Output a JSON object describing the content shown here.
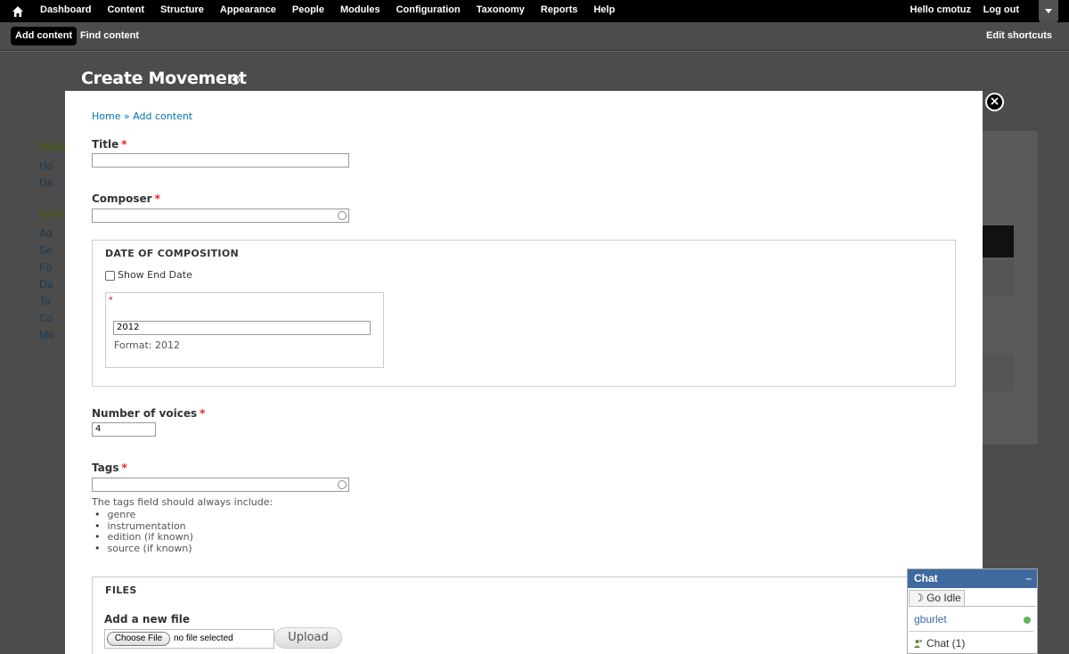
{
  "toolbar": {
    "menu": [
      "Dashboard",
      "Content",
      "Structure",
      "Appearance",
      "People",
      "Modules",
      "Configuration",
      "Taxonomy",
      "Reports",
      "Help"
    ],
    "hello": "Hello ",
    "username": "cmotuz",
    "logout": "Log out"
  },
  "shortcuts": {
    "add_content": "Add content",
    "find_content": "Find content",
    "edit_shortcuts": "Edit shortcuts"
  },
  "background": {
    "left_menu": [
      {
        "type": "h",
        "text": "MAIN"
      },
      {
        "type": "i",
        "text": "Ho"
      },
      {
        "type": "i",
        "text": "Da"
      },
      {
        "type": "h",
        "text": "NAVI"
      },
      {
        "type": "i",
        "text": "Ad"
      },
      {
        "type": "i",
        "text": "Se"
      },
      {
        "type": "i",
        "text": "Fo"
      },
      {
        "type": "i",
        "text": "Da"
      },
      {
        "type": "i",
        "text": "Ta"
      },
      {
        "type": "i",
        "text": "Co"
      },
      {
        "type": "i",
        "text": "Mo"
      }
    ]
  },
  "page": {
    "title": "Create Movement",
    "close_symbol": "×"
  },
  "form": {
    "breadcrumb": "Home » Add content",
    "title_label": "Title",
    "composer_label": "Composer",
    "date_legend": "DATE OF COMPOSITION",
    "show_end_date": "Show End Date",
    "date_value": "2012",
    "date_format": "Format: 2012",
    "voices_label": "Number of voices",
    "voices_value": "4",
    "tags_label": "Tags",
    "tags_desc": "The tags field should always include:",
    "tags_items": [
      "genre",
      "instrumentation",
      "edition (if known)",
      "source (if known)"
    ],
    "files_legend": "FILES",
    "add_file_label": "Add a new file",
    "choose_file": "Choose File",
    "no_file": "no file selected",
    "upload": "Upload",
    "required_mark": "*"
  },
  "chat": {
    "title": "Chat",
    "minimize": "–",
    "go_idle": "Go Idle",
    "user": "gburlet",
    "count": "Chat (1)"
  }
}
